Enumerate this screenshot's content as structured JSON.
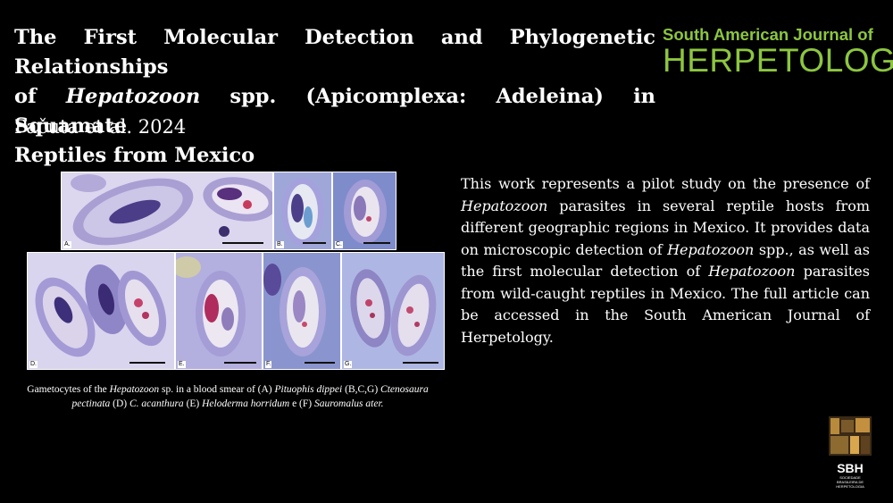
{
  "title": {
    "line1": "The First Molecular Detection and Phylogenetic Relationships",
    "line2_before": "of ",
    "line2_italic": "Hepatozoon",
    "line2_after": " spp. (Apicomplexa: Adeleina) in Squamate",
    "line3": "Reptiles from Mexico"
  },
  "authors": "Pačuta et al. 2024",
  "journal": {
    "line1": "South American Journal of",
    "line2": "HERPETOLOGY",
    "color": "#8cc63f"
  },
  "figure": {
    "panels": [
      {
        "label": "A."
      },
      {
        "label": "B."
      },
      {
        "label": "C."
      },
      {
        "label": "D."
      },
      {
        "label": "E."
      },
      {
        "label": "F."
      },
      {
        "label": "G."
      }
    ]
  },
  "caption": {
    "t1": "Gametocytes of the ",
    "i1": "Hepatozoon",
    "t2": " sp. in a blood smear of (A) ",
    "i2": "Pituophis dippei",
    "t3": " (B,C,G) ",
    "i3": "Ctenosaura pectinata",
    "t4": " (D) ",
    "i4": "C. acanthura",
    "t5": " (E) ",
    "i5": "Heloderma horridum",
    "t6": " e (F) ",
    "i6": "Sauromalus ater.",
    "t7": ""
  },
  "body": {
    "t1": "This work represents a pilot study on the presence of ",
    "i1": "Hepatozoon",
    "t2": " parasites in several reptile hosts from different geographic regions in Mexico. It provides data on microscopic detection of ",
    "i2": "Hepatozoon",
    "t3": " spp., as well as the first molecular detection of ",
    "i3": "Hepatozoon",
    "t4": " parasites from wild-caught reptiles in Mexico. The full article can be accessed in the South American Journal of Herpetology."
  },
  "logo": {
    "abbr": "SBH",
    "tiny": "SOCIEDADE BRASILEIRA DE HERPETOLOGIA"
  }
}
